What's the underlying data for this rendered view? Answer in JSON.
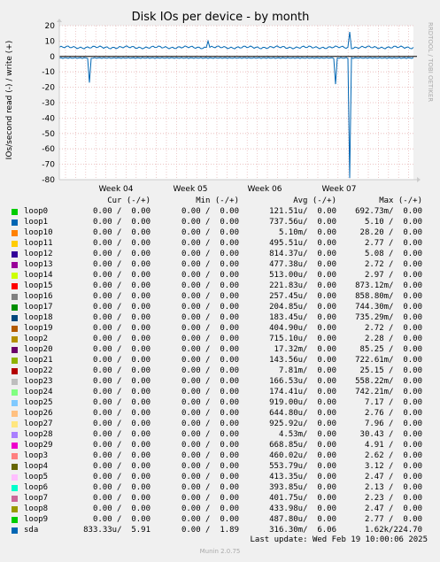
{
  "chart_data": {
    "type": "line",
    "title": "Disk IOs per device - by month",
    "ylabel": "IOs/second read (-) / write (+)",
    "ylim": [
      -80,
      20
    ],
    "yticks": [
      20,
      10,
      0,
      -10,
      -20,
      -30,
      -40,
      -50,
      -60,
      -70,
      -80
    ],
    "xticks": [
      "Week 04",
      "Week 05",
      "Week 06",
      "Week 07"
    ],
    "grid": true,
    "series": [
      {
        "name": "sda",
        "color": "#0066b3",
        "baseline_write": 5.9,
        "baseline_read": -1.0,
        "write_spikes": [
          {
            "x": 0.42,
            "value": 10.0
          },
          {
            "x": 0.82,
            "value": 16.0
          }
        ],
        "read_spikes": [
          {
            "x": 0.084,
            "value": -17.0
          },
          {
            "x": 0.781,
            "value": -18.0
          },
          {
            "x": 0.82,
            "value": -79.0
          }
        ]
      }
    ]
  },
  "side_label": "RRDTOOL / TOBI OETIKER",
  "legend": {
    "headers": [
      "Cur (-/+)",
      "Min (-/+)",
      "Avg (-/+)",
      "Max (-/+)"
    ],
    "rows": [
      {
        "name": "loop0",
        "color": "#00cc00",
        "cur": "0.00 /  0.00",
        "min": "0.00 /  0.00",
        "avg": "121.51u/  0.00",
        "max": "692.73m/  0.00"
      },
      {
        "name": "loop1",
        "color": "#0066b3",
        "cur": "0.00 /  0.00",
        "min": "0.00 /  0.00",
        "avg": "737.56u/  0.00",
        "max": "5.10 /  0.00"
      },
      {
        "name": "loop10",
        "color": "#ff8000",
        "cur": "0.00 /  0.00",
        "min": "0.00 /  0.00",
        "avg": "5.10m/  0.00",
        "max": "28.20 /  0.00"
      },
      {
        "name": "loop11",
        "color": "#ffcc00",
        "cur": "0.00 /  0.00",
        "min": "0.00 /  0.00",
        "avg": "495.51u/  0.00",
        "max": "2.77 /  0.00"
      },
      {
        "name": "loop12",
        "color": "#330099",
        "cur": "0.00 /  0.00",
        "min": "0.00 /  0.00",
        "avg": "814.37u/  0.00",
        "max": "5.08 /  0.00"
      },
      {
        "name": "loop13",
        "color": "#990099",
        "cur": "0.00 /  0.00",
        "min": "0.00 /  0.00",
        "avg": "477.38u/  0.00",
        "max": "2.72 /  0.00"
      },
      {
        "name": "loop14",
        "color": "#ccff00",
        "cur": "0.00 /  0.00",
        "min": "0.00 /  0.00",
        "avg": "513.00u/  0.00",
        "max": "2.97 /  0.00"
      },
      {
        "name": "loop15",
        "color": "#ff0000",
        "cur": "0.00 /  0.00",
        "min": "0.00 /  0.00",
        "avg": "221.83u/  0.00",
        "max": "873.12m/  0.00"
      },
      {
        "name": "loop16",
        "color": "#808080",
        "cur": "0.00 /  0.00",
        "min": "0.00 /  0.00",
        "avg": "257.45u/  0.00",
        "max": "858.80m/  0.00"
      },
      {
        "name": "loop17",
        "color": "#008f00",
        "cur": "0.00 /  0.00",
        "min": "0.00 /  0.00",
        "avg": "204.85u/  0.00",
        "max": "744.30m/  0.00"
      },
      {
        "name": "loop18",
        "color": "#00487d",
        "cur": "0.00 /  0.00",
        "min": "0.00 /  0.00",
        "avg": "183.45u/  0.00",
        "max": "735.29m/  0.00"
      },
      {
        "name": "loop19",
        "color": "#b35a00",
        "cur": "0.00 /  0.00",
        "min": "0.00 /  0.00",
        "avg": "404.90u/  0.00",
        "max": "2.72 /  0.00"
      },
      {
        "name": "loop2",
        "color": "#b38f00",
        "cur": "0.00 /  0.00",
        "min": "0.00 /  0.00",
        "avg": "715.10u/  0.00",
        "max": "2.28 /  0.00"
      },
      {
        "name": "loop20",
        "color": "#6b006b",
        "cur": "0.00 /  0.00",
        "min": "0.00 /  0.00",
        "avg": "17.32m/  0.00",
        "max": "85.25 /  0.00"
      },
      {
        "name": "loop21",
        "color": "#8fb300",
        "cur": "0.00 /  0.00",
        "min": "0.00 /  0.00",
        "avg": "143.56u/  0.00",
        "max": "722.61m/  0.00"
      },
      {
        "name": "loop22",
        "color": "#b30000",
        "cur": "0.00 /  0.00",
        "min": "0.00 /  0.00",
        "avg": "7.81m/  0.00",
        "max": "25.15 /  0.00"
      },
      {
        "name": "loop23",
        "color": "#bebebe",
        "cur": "0.00 /  0.00",
        "min": "0.00 /  0.00",
        "avg": "166.53u/  0.00",
        "max": "558.22m/  0.00"
      },
      {
        "name": "loop24",
        "color": "#80ff80",
        "cur": "0.00 /  0.00",
        "min": "0.00 /  0.00",
        "avg": "174.41u/  0.00",
        "max": "742.21m/  0.00"
      },
      {
        "name": "loop25",
        "color": "#80c9ff",
        "cur": "0.00 /  0.00",
        "min": "0.00 /  0.00",
        "avg": "919.00u/  0.00",
        "max": "7.17 /  0.00"
      },
      {
        "name": "loop26",
        "color": "#ffc080",
        "cur": "0.00 /  0.00",
        "min": "0.00 /  0.00",
        "avg": "644.80u/  0.00",
        "max": "2.76 /  0.00"
      },
      {
        "name": "loop27",
        "color": "#ffe680",
        "cur": "0.00 /  0.00",
        "min": "0.00 /  0.00",
        "avg": "925.92u/  0.00",
        "max": "7.96 /  0.00"
      },
      {
        "name": "loop28",
        "color": "#aa80ff",
        "cur": "0.00 /  0.00",
        "min": "0.00 /  0.00",
        "avg": "4.53m/  0.00",
        "max": "30.43 /  0.00"
      },
      {
        "name": "loop29",
        "color": "#ee00cc",
        "cur": "0.00 /  0.00",
        "min": "0.00 /  0.00",
        "avg": "668.85u/  0.00",
        "max": "4.91 /  0.00"
      },
      {
        "name": "loop3",
        "color": "#ff8080",
        "cur": "0.00 /  0.00",
        "min": "0.00 /  0.00",
        "avg": "460.02u/  0.00",
        "max": "2.62 /  0.00"
      },
      {
        "name": "loop4",
        "color": "#666600",
        "cur": "0.00 /  0.00",
        "min": "0.00 /  0.00",
        "avg": "553.79u/  0.00",
        "max": "3.12 /  0.00"
      },
      {
        "name": "loop5",
        "color": "#ffbfff",
        "cur": "0.00 /  0.00",
        "min": "0.00 /  0.00",
        "avg": "413.35u/  0.00",
        "max": "2.47 /  0.00"
      },
      {
        "name": "loop6",
        "color": "#00ffcc",
        "cur": "0.00 /  0.00",
        "min": "0.00 /  0.00",
        "avg": "393.85u/  0.00",
        "max": "2.13 /  0.00"
      },
      {
        "name": "loop7",
        "color": "#cc6699",
        "cur": "0.00 /  0.00",
        "min": "0.00 /  0.00",
        "avg": "401.75u/  0.00",
        "max": "2.23 /  0.00"
      },
      {
        "name": "loop8",
        "color": "#999900",
        "cur": "0.00 /  0.00",
        "min": "0.00 /  0.00",
        "avg": "433.98u/  0.00",
        "max": "2.47 /  0.00"
      },
      {
        "name": "loop9",
        "color": "#00cc00",
        "cur": "0.00 /  0.00",
        "min": "0.00 /  0.00",
        "avg": "487.80u/  0.00",
        "max": "2.77 /  0.00"
      },
      {
        "name": "sda",
        "color": "#0066b3",
        "cur": "833.33u/  5.91",
        "min": "0.00 /  1.89",
        "avg": "316.30m/  6.06",
        "max": "1.62k/224.70"
      }
    ]
  },
  "footer": {
    "last_update": "Last update: Wed Feb 19 10:00:06 2025",
    "munin": "Munin 2.0.75"
  }
}
